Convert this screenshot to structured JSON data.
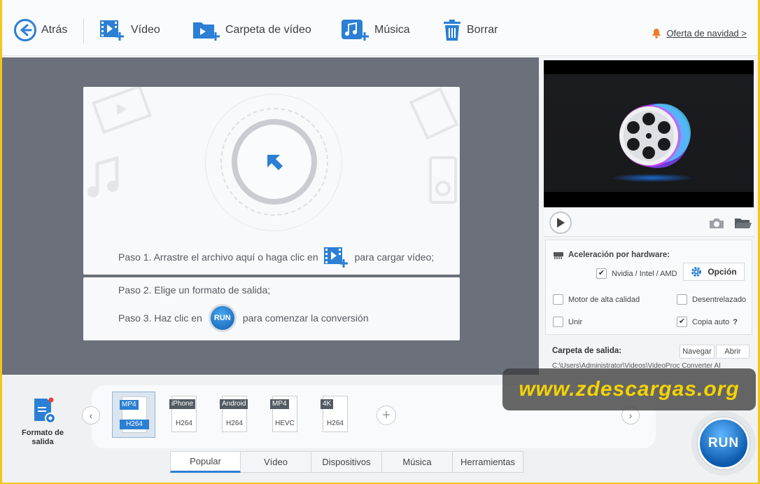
{
  "toolbar": {
    "back": "Atrás",
    "video": "Vídeo",
    "folder": "Carpeta de vídeo",
    "music": "Música",
    "delete": "Borrar",
    "offer": "Oferta de navidad >"
  },
  "drop": {
    "step1_a": "Paso 1. Arrastre el archivo aquí o haga clic en",
    "step1_b": "para cargar vídeo;",
    "step2": "Paso 2. Elige un formato de salida;",
    "step3_a": "Paso 3. Haz clic en",
    "step3_run": "RUN",
    "step3_b": "para comenzar la conversión"
  },
  "settings": {
    "hw_title": "Aceleración por hardware:",
    "hw_option": "Nvidia / Intel / AMD",
    "hw_checked": true,
    "option_btn": "Opción",
    "high_quality": "Motor de alta calidad",
    "deinterlace": "Desentrelazado",
    "merge": "Unir",
    "autocopy": "Copia auto",
    "autocopy_help": "?",
    "autocopy_checked": true
  },
  "output": {
    "label": "Carpeta de salida:",
    "browse": "Navegar",
    "open": "Abrir",
    "path": "C:\\Users\\Administrator\\Videos\\VideoProc Converter AI"
  },
  "formats": {
    "title": "Formato de salida",
    "items": [
      {
        "top": "MP4",
        "bottom": "H264",
        "selected": true
      },
      {
        "top": "iPhone",
        "bottom": "H264",
        "selected": false
      },
      {
        "top": "Android",
        "bottom": "H264",
        "selected": false
      },
      {
        "top": "MP4",
        "bottom": "HEVC",
        "selected": false
      },
      {
        "top": "4K",
        "bottom": "H264",
        "selected": false
      }
    ]
  },
  "tabs": [
    "Popular",
    "Vídeo",
    "Dispositivos",
    "Música",
    "Herramientas"
  ],
  "run": "RUN",
  "watermark": "www.zdescargas.org",
  "colors": {
    "accent": "#2b7fd4",
    "watermark": "#f5d300",
    "frame": "#f5c518"
  }
}
